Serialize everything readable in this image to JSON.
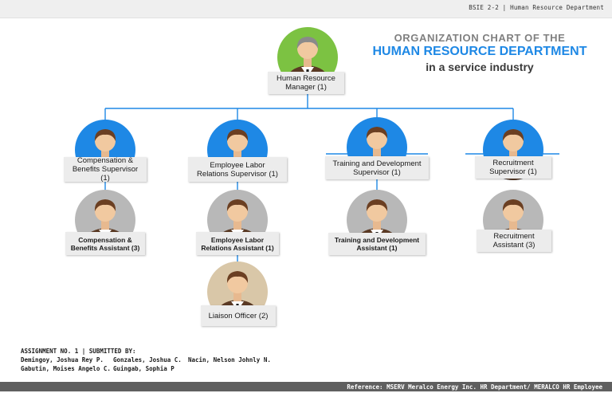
{
  "header": {
    "course_label": "BSIE 2-2 | Human Resource Department"
  },
  "title": {
    "line1": "ORGANIZATION CHART OF THE",
    "line2": "HUMAN RESOURCE DEPARTMENT",
    "line3": "in a service industry"
  },
  "colors": {
    "manager_circle": "#7cc242",
    "supervisor_circle": "#1e88e5",
    "assistant_circle": "#b8b8b8",
    "liaison_circle": "#d9c7a8",
    "connector": "#1e88e5"
  },
  "nodes": {
    "manager": {
      "label": "Human Resource\nManager (1)",
      "icon": "male-avatar-icon"
    },
    "comp_supervisor": {
      "label": "Compensation &\nBenefits Supervisor (1)",
      "icon": "male-avatar-icon"
    },
    "labor_supervisor": {
      "label": "Employee Labor\nRelations Supervisor (1)",
      "icon": "male-avatar-icon"
    },
    "training_supervisor": {
      "label": "Training and Development\nSupervisor (1)",
      "icon": "male-avatar-icon"
    },
    "recruit_supervisor": {
      "label": "Recruitment\nSupervisor (1)",
      "icon": "male-avatar-icon"
    },
    "comp_assistant": {
      "label": "Compensation &\nBenefits Assistant (3)",
      "icon": "male-avatar-icon"
    },
    "labor_assistant": {
      "label": "Employee Labor\nRelations Assistant (1)",
      "icon": "male-avatar-icon"
    },
    "training_assistant": {
      "label": "Training and Development\nAssistant (1)",
      "icon": "male-avatar-icon"
    },
    "recruit_assistant": {
      "label": "Recruitment\nAssistant (3)",
      "icon": "male-avatar-icon"
    },
    "liaison": {
      "label": "Liaison Officer (2)",
      "icon": "male-avatar-icon"
    }
  },
  "credits": {
    "heading": "ASSIGNMENT NO. 1 | SUBMITTED BY:",
    "names": [
      "Demingoy, Joshua Rey P.",
      "Gonzales, Joshua C.",
      "Nacin, Nelson Johnly N.",
      "Gabutin, Moises Angelo C.",
      "Guingab, Sophia P"
    ]
  },
  "footer": {
    "reference": "Reference: MSERV Meralco Energy Inc. HR Department/ MERALCO HR Employee"
  }
}
